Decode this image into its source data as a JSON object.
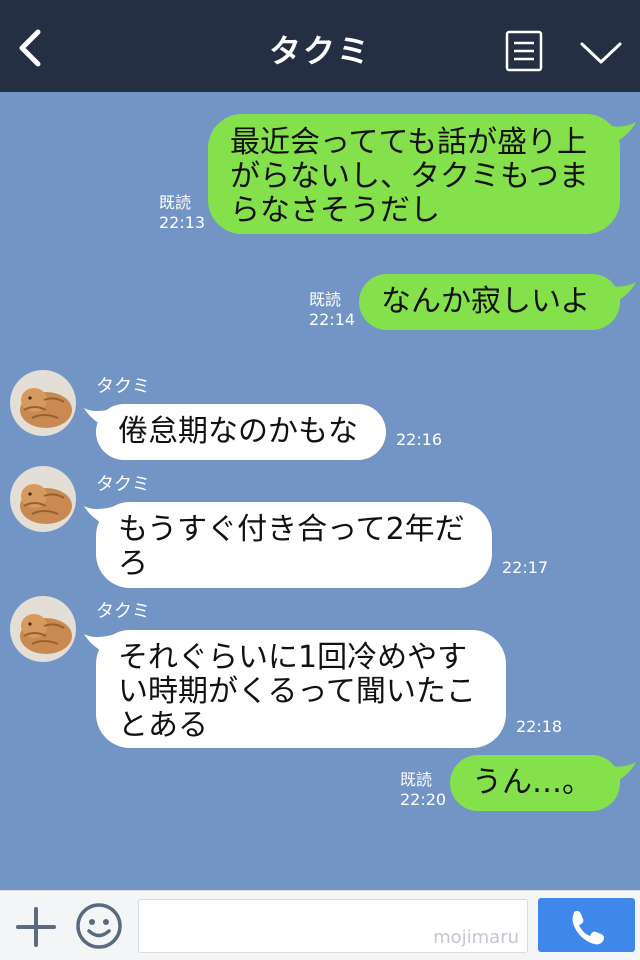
{
  "header": {
    "title": "タクミ",
    "back_icon": "chevron-left-icon",
    "menu_icon": "list-icon",
    "dropdown_icon": "chevron-down-icon"
  },
  "messages": [
    {
      "from": "me",
      "read_label": "既読",
      "time": "22:13",
      "lines": [
        "最近会ってても話が盛り上",
        "がらないし、タクミもつま",
        "らなさそうだし"
      ]
    },
    {
      "from": "me",
      "read_label": "既読",
      "time": "22:14",
      "lines": [
        "なんか寂しいよ"
      ]
    },
    {
      "from": "them",
      "sender": "タクミ",
      "time": "22:16",
      "lines": [
        "倦怠期なのかもな"
      ]
    },
    {
      "from": "them",
      "sender": "タクミ",
      "time": "22:17",
      "lines": [
        "もうすぐ付き合って2年だ",
        "ろ"
      ]
    },
    {
      "from": "them",
      "sender": "タクミ",
      "time": "22:18",
      "lines": [
        "それぐらいに1回冷めやす",
        "い時期がくるって聞いたこ",
        "とある"
      ]
    },
    {
      "from": "me",
      "read_label": "既読",
      "time": "22:20",
      "lines": [
        "うん…。"
      ]
    }
  ],
  "footer": {
    "plus_icon": "plus-icon",
    "emoji_icon": "smiley-icon",
    "input_value": "",
    "watermark": "mojimaru",
    "call_icon": "phone-icon"
  },
  "colors": {
    "header_bg": "#252f44",
    "chat_bg": "#7395c5",
    "my_bubble": "#84e14b",
    "their_bubble": "#ffffff",
    "call_button": "#3f87ea"
  }
}
